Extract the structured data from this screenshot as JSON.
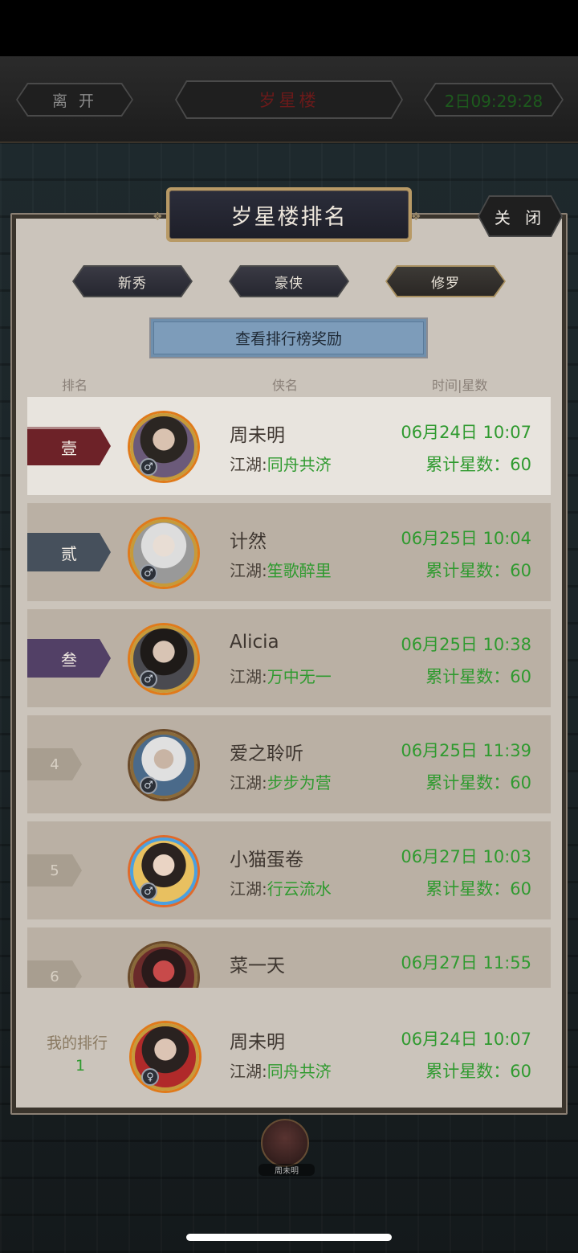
{
  "topbar": {
    "leave_label": "离 开",
    "title": "岁星楼",
    "timer": "2日09:29:28"
  },
  "panel": {
    "title": "岁星楼排名",
    "close_label": "关 闭",
    "tabs": [
      {
        "label": "新秀",
        "active": false
      },
      {
        "label": "豪侠",
        "active": false
      },
      {
        "label": "修罗",
        "active": true
      }
    ],
    "reward_button": "查看排行榜奖励",
    "columns": {
      "rank": "排名",
      "name": "侠名",
      "time_stars": "时间|星数"
    },
    "jianghu_prefix": "江湖:",
    "stars_prefix": "累计星数：",
    "rows": [
      {
        "rank": "壹",
        "name": "周未明",
        "jianghu": "同舟共济",
        "time": "06月24日 10:07",
        "stars": "60",
        "gender": "♂"
      },
      {
        "rank": "贰",
        "name": "计然",
        "jianghu": "笙歌醉里",
        "time": "06月25日 10:04",
        "stars": "60",
        "gender": "♂"
      },
      {
        "rank": "叁",
        "name": "Alicia",
        "jianghu": "万中无一",
        "time": "06月25日 10:38",
        "stars": "60",
        "gender": "♂"
      },
      {
        "rank": "4",
        "name": "爱之聆听",
        "jianghu": "步步为营",
        "time": "06月25日 11:39",
        "stars": "60",
        "gender": "♂"
      },
      {
        "rank": "5",
        "name": "小猫蛋卷",
        "jianghu": "行云流水",
        "time": "06月27日 10:03",
        "stars": "60",
        "gender": "♂"
      },
      {
        "rank": "6",
        "name": "菜一天",
        "jianghu": "",
        "time": "06月27日 11:55",
        "stars": "",
        "gender": ""
      }
    ],
    "my_rank": {
      "label": "我的排行",
      "rank": "1",
      "name": "周未明",
      "jianghu": "同舟共济",
      "time": "06月24日 10:07",
      "stars": "60",
      "gender": "♀"
    }
  },
  "floor": {
    "player_name": "周未明"
  },
  "colors": {
    "green": "#2f9a2f",
    "rank1": "#6d2228",
    "rank2": "#46505c",
    "rank3": "#524066"
  }
}
